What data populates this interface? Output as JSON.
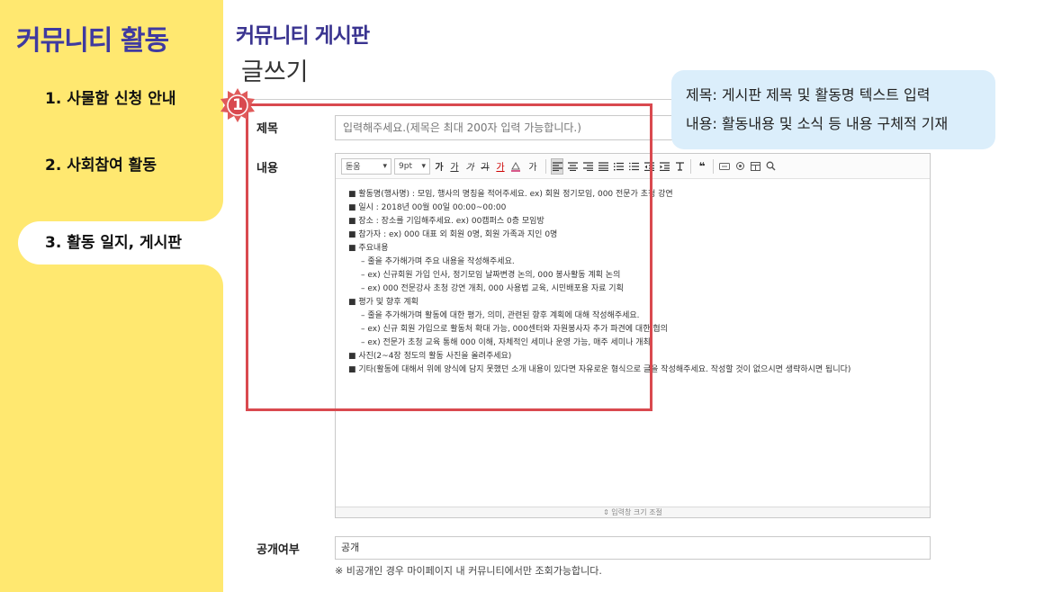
{
  "sidebar": {
    "title": "커뮤니티 활동",
    "items": [
      {
        "label": "1. 사물함 신청 안내"
      },
      {
        "label": "2. 사회참여 활동"
      },
      {
        "label": "3. 활동 일지, 게시판"
      }
    ]
  },
  "header": {
    "title": "커뮤니티 게시판",
    "subtitle": "글쓰기"
  },
  "form": {
    "title_label": "제목",
    "title_placeholder": "입력해주세요.(제목은 최대 200자 입력 가능합니다.)",
    "content_label": "내용",
    "public_label": "공개여부",
    "public_value": "공개",
    "public_note": "※ 비공개인 경우 마이페이지 내 커뮤니티에서만 조회가능합니다."
  },
  "toolbar": {
    "font": "돋움",
    "size": "9pt",
    "bold": "가",
    "underline": "가",
    "italic": "가",
    "strike": "가",
    "font_color": "가",
    "superscript": "가"
  },
  "editor": {
    "lines": [
      "■ 활동명(행사명) : 모임, 행사의 명칭을 적어주세요. ex) 회원 정기모임, 000 전문가 초청 강연",
      "■ 일시 : 2018년 00월 00일 00:00~00:00",
      "■ 장소 : 장소를 기입해주세요. ex) 00캠퍼스 0층 모임방",
      "■ 참가자 : ex) 000 대표 외 회원 0명, 회원 가족과 지인 0명",
      "■ 주요내용",
      "– 줄을 추가해가며 주요 내용을 작성해주세요.",
      "– ex) 신규회원 가입 인사, 정기모임 날짜변경 논의, 000 봉사활동 계획 논의",
      "– ex) 000 전문강사 초청 강연 개최, 000 사용법 교육, 시민배포용 자료 기획",
      "■ 평가 및 향후 계획",
      "– 줄을 추가해가며 활동에 대한 평가, 의미, 관련된 향후 계획에 대해 작성해주세요.",
      "– ex) 신규 회원 가입으로 활동처 확대 가능, 000센터와 자원봉사자 추가 파견에 대한 협의",
      "– ex) 전문가 초청 교육 통해 000 이해, 자체적인 세미나 운영 가능, 매주 세미나 개최",
      "■ 사진(2~4장 정도의 활동 사진을 올려주세요)",
      "■ 기타(활동에 대해서 위에 양식에 담지 못했던 소개 내용이 있다면 자유로운 형식으로 글을 작성해주세요. 작성할 것이 없으시면 생략하시면 됩니다)"
    ],
    "resize_label": "⇕ 입력창 크기 조절"
  },
  "annotation": {
    "number": "1",
    "callout_line1": "제목: 게시판 제목 및 활동명 텍스트 입력",
    "callout_line2": "내용: 활동내용 및 소식 등 내용 구체적 기재"
  },
  "colors": {
    "sidebar_bg": "#ffe870",
    "title_purple": "#3a3490",
    "highlight_red": "#d9494f",
    "callout_bg": "#dbeefb"
  }
}
